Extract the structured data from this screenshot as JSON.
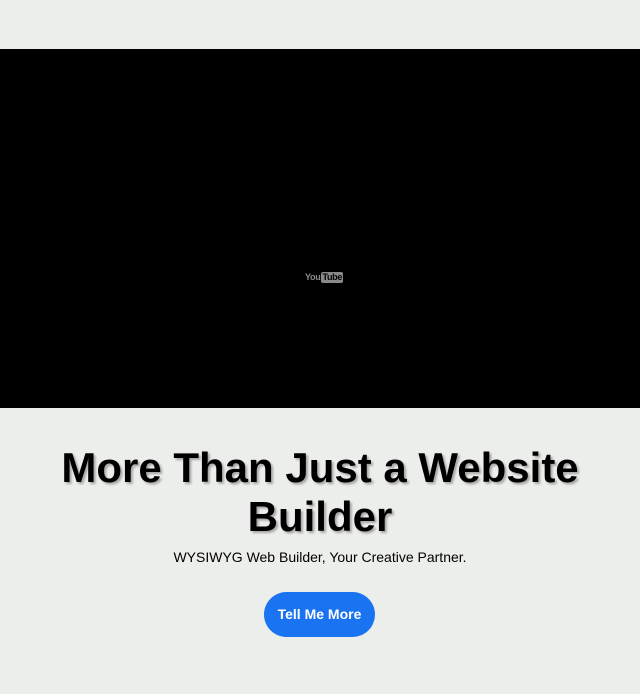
{
  "video": {
    "logo_you": "You",
    "logo_tube": "Tube"
  },
  "hero": {
    "title": "More Than Just a Website Builder",
    "subtitle": "WYSIWYG Web Builder, Your Creative Partner.",
    "cta_label": "Tell Me More"
  },
  "colors": {
    "background": "#eceeeb",
    "video_background": "#000000",
    "cta_background": "#1a73f0",
    "cta_text": "#ffffff"
  }
}
